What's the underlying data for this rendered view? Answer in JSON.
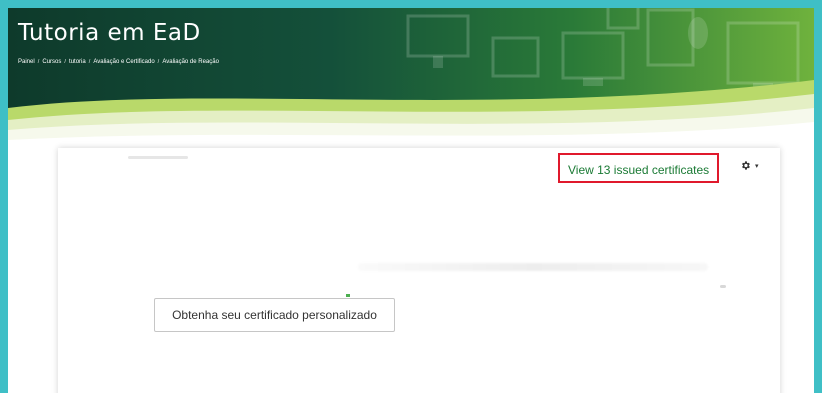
{
  "header": {
    "site_title": "Tutoria em EaD",
    "breadcrumb": [
      "Painel",
      "Cursos",
      "tutoria",
      "Avaliação e Certificado",
      "Avaliação de Reação"
    ]
  },
  "main": {
    "view_certificates_link": "View 13 issued certificates",
    "settings_icon": "gear-icon",
    "settings_caret": "▾",
    "get_certificate_button": "Obtenha seu certificado personalizado"
  },
  "colors": {
    "background_border": "#3fbfc6",
    "banner_dark": "#0e3a2b",
    "banner_light": "#6fb23d",
    "link_green": "#1a7a34",
    "highlight_red": "#e0192c"
  }
}
